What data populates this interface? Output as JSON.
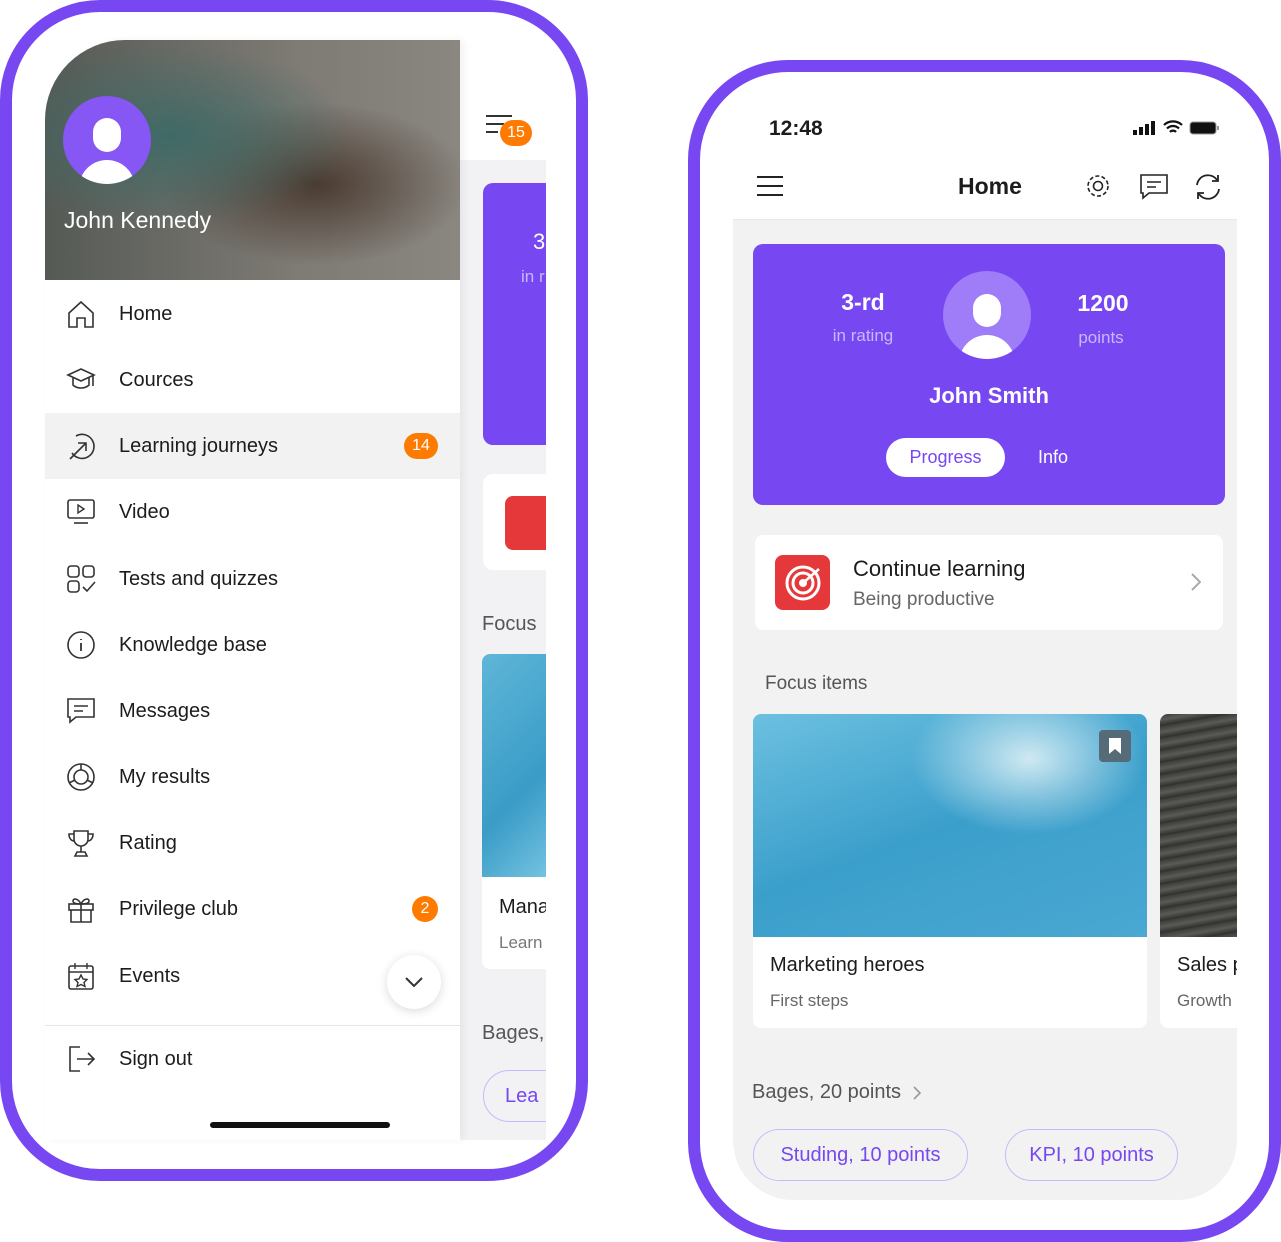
{
  "colors": {
    "accent": "#7747F2",
    "badge": "#FF7A00",
    "target_icon": "#E5383B"
  },
  "drawer": {
    "user_name": "John Kennedy",
    "menu_badge": "15",
    "items": [
      {
        "label": "Home",
        "icon": "home-icon"
      },
      {
        "label": "Cources",
        "icon": "graduation-cap-icon"
      },
      {
        "label": "Learning journeys",
        "icon": "arrow-circle-icon",
        "badge": "14",
        "active": true
      },
      {
        "label": "Video",
        "icon": "video-icon"
      },
      {
        "label": "Tests and quizzes",
        "icon": "tests-grid-icon"
      },
      {
        "label": "Knowledge base",
        "icon": "info-icon"
      },
      {
        "label": "Messages",
        "icon": "message-icon"
      },
      {
        "label": "My results",
        "icon": "results-icon"
      },
      {
        "label": "Rating",
        "icon": "trophy-icon"
      },
      {
        "label": "Privilege club",
        "icon": "gift-icon",
        "badge": "2"
      },
      {
        "label": "Events",
        "icon": "calendar-star-icon"
      }
    ],
    "sign_out": "Sign out",
    "behind": {
      "rank": "3",
      "rank_sub": "in r",
      "focus": "Focus",
      "card_title": "Mana",
      "card_sub": "Learn",
      "bages": "Bages,",
      "pill": "Lea"
    }
  },
  "home": {
    "status": {
      "time": "12:48"
    },
    "title": "Home",
    "profile": {
      "rank": "3-rd",
      "rank_label": "in rating",
      "points": "1200",
      "points_label": "points",
      "name": "John Smith",
      "tabs": [
        "Progress",
        "Info"
      ],
      "active_tab": "Progress"
    },
    "continue": {
      "title": "Continue learning",
      "subtitle": "Being productive"
    },
    "focus_title": "Focus items",
    "focus_items": [
      {
        "title": "Marketing heroes",
        "subtitle": "First steps",
        "bookmarked": true
      },
      {
        "title": "Sales p",
        "subtitle": "Growth"
      }
    ],
    "bages_title": "Bages, 20 points",
    "bages": [
      "Studing, 10 points",
      "KPI, 10 points"
    ]
  }
}
